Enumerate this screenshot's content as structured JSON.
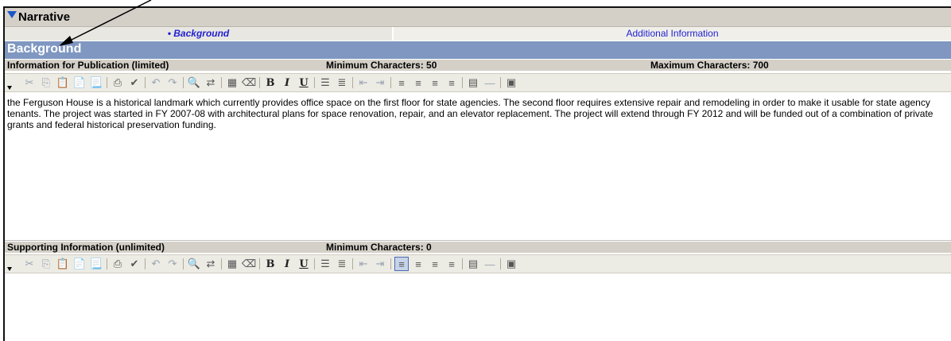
{
  "narrative": {
    "title": "Narrative"
  },
  "tabs": [
    {
      "label": "• Background",
      "active": true
    },
    {
      "label": "Additional Information",
      "active": false
    }
  ],
  "section": {
    "title": "Background"
  },
  "info_section": {
    "label": "Information for Publication (limited)",
    "min_chars": "Minimum Characters: 50",
    "max_chars": "Maximum Characters: 700",
    "text": "the Ferguson House is a historical landmark which currently provides office space on the first floor for state agencies.  The second floor requires extensive repair and remodeling in order to make it usable for state agency tenants.  The project was started in FY 2007-08 with architectural plans for space renovation, repair, and an elevator replacement.  The project will extend through FY 2012 and will be funded out of a combination of private grants and federal historical preservation funding."
  },
  "support_section": {
    "label": "Supporting Information (unlimited)",
    "min_chars": "Minimum Characters: 0",
    "text": ""
  },
  "toolbar_icons": [
    "cut-icon",
    "copy-icon",
    "paste-icon",
    "paste-text-icon",
    "paste-word-icon",
    "print-icon",
    "spellcheck-icon",
    "undo-icon",
    "redo-icon",
    "find-icon",
    "replace-icon",
    "select-all-icon",
    "remove-format-icon",
    "bold-icon",
    "italic-icon",
    "underline-icon",
    "ordered-list-icon",
    "unordered-list-icon",
    "outdent-icon",
    "indent-icon",
    "align-left-icon",
    "align-center-icon",
    "align-right-icon",
    "justify-icon",
    "table-icon",
    "horizontal-rule-icon",
    "source-icon"
  ],
  "colors": {
    "section_header": "#7f97c1",
    "tab_link": "#1f1fd1",
    "narrative_bar": "#d4d0c8"
  }
}
